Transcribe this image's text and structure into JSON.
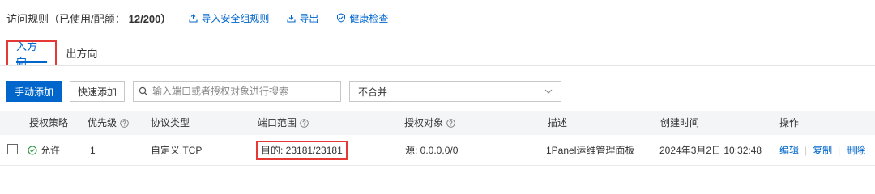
{
  "header": {
    "title": "访问规则（已使用/配额：",
    "count": "12/200）",
    "links": [
      {
        "label": "导入安全组规则",
        "icon": "upload-icon"
      },
      {
        "label": "导出",
        "icon": "download-icon"
      },
      {
        "label": "健康检查",
        "icon": "shield-check-icon"
      }
    ]
  },
  "tabs": [
    {
      "label": "入方向",
      "active": true
    },
    {
      "label": "出方向",
      "active": false
    }
  ],
  "toolbar": {
    "add_manual": "手动添加",
    "add_quick": "快速添加",
    "search_placeholder": "输入端口或者授权对象进行搜索",
    "merge_select": "不合并"
  },
  "table": {
    "columns": [
      "授权策略",
      "优先级",
      "协议类型",
      "端口范围",
      "授权对象",
      "描述",
      "创建时间",
      "操作"
    ],
    "rows": [
      {
        "policy": "允许",
        "priority": "1",
        "protocol": "自定义 TCP",
        "port_range": "目的: 23181/23181",
        "source": "源: 0.0.0.0/0",
        "description": "1Panel运维管理面板",
        "created": "2024年3月2日 10:32:48",
        "actions": [
          "编辑",
          "复制",
          "删除"
        ]
      }
    ]
  },
  "colors": {
    "accent": "#0066cc",
    "highlight": "#e53935",
    "success": "#2e9a44"
  }
}
